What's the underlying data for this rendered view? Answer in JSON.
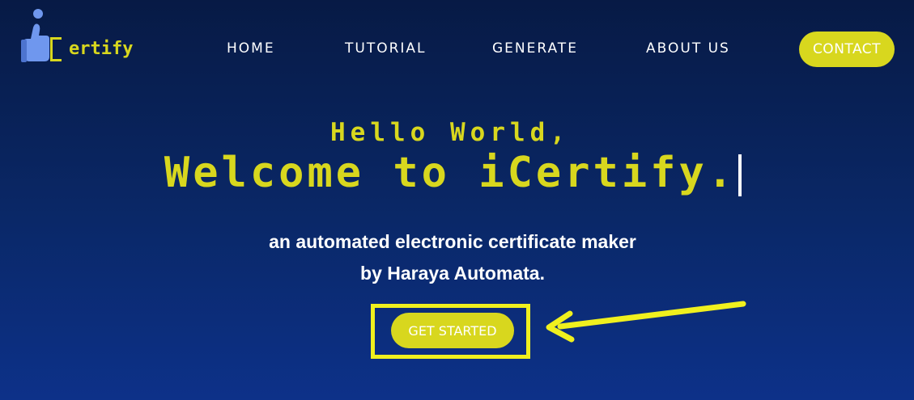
{
  "brand": {
    "logo_text": "ertify"
  },
  "nav": {
    "items": [
      {
        "label": "HOME"
      },
      {
        "label": "TUTORIAL"
      },
      {
        "label": "GENERATE"
      },
      {
        "label": "ABOUT US"
      }
    ],
    "contact_label": "CONTACT"
  },
  "hero": {
    "greeting": "Hello World,",
    "headline": "Welcome to iCertify.",
    "subtitle_line1": "an automated electronic certificate maker",
    "subtitle_line2": "by Haraya Automata.",
    "cta_label": "GET STARTED"
  },
  "colors": {
    "accent": "#d8d71e",
    "highlight": "#f0f01e",
    "background_top": "#071a45",
    "background_bottom": "#0d3189",
    "logo_blue": "#6f97ee"
  }
}
